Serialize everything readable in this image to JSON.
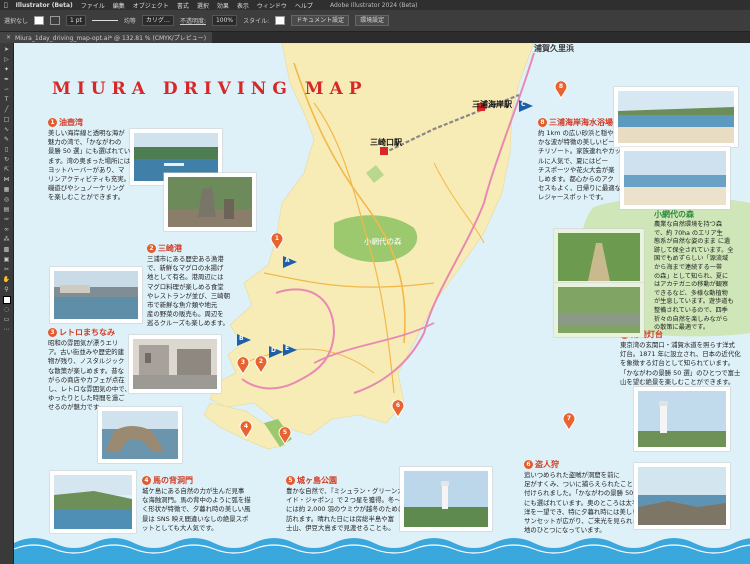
{
  "app": {
    "menu": [
      "Illustrator (Beta)",
      "ファイル",
      "編集",
      "オブジェクト",
      "書式",
      "選択",
      "効果",
      "表示",
      "ウィンドウ",
      "ヘルプ"
    ],
    "window_title": "Adobe Illustrator 2024 (Beta)",
    "control": {
      "selection_label": "選択なし",
      "stroke_weight": "1 pt",
      "stroke_profile": "均等",
      "brush": "カリグ…",
      "opacity_label": "不透明度:",
      "opacity_value": "100%",
      "style_label": "スタイル:",
      "doc_setup": "ドキュメント設定",
      "preferences": "環境設定"
    },
    "tab_label": "Miura_1day_driving_map-opt.ai* @ 132.81 % (CMYK/プレビュー)",
    "tab_close": "×"
  },
  "map": {
    "title": "MIURA DRIVING MAP",
    "top_cut_label": "浦賀久里浜",
    "stations": {
      "misakiguchi": "三崎口駅",
      "miurakaigan": "三浦海岸駅"
    },
    "forest_label": "小網代の森",
    "flags": [
      "A",
      "B",
      "C",
      "D",
      "E"
    ],
    "pins": [
      "1",
      "2",
      "3",
      "4",
      "5",
      "6",
      "7",
      "8"
    ],
    "spots": [
      {
        "num": "1",
        "title": "油壺湾",
        "text": [
          "美しい海岸線と透明な海が",
          "魅力の湾で、「かながわの",
          "景勝 50 選」にも選ばれてい",
          "ます。湾の奥まった場所には",
          "ヨットハーバーがあり、マ",
          "リンアクティビティも充実。",
          "磯遊びやシュノーケリング",
          "を楽しむことができます。"
        ]
      },
      {
        "num": "2",
        "title": "三崎港",
        "text": [
          "三浦市にある歴史ある漁港",
          "で、新鮮なマグロの水揚げ",
          "地として有名。港周辺には",
          "マグロ料理が楽しめる食堂",
          "やレストランが並び、三崎朝",
          "市で新鮮な魚介類や地元",
          "産の野菜の販売も。周辺を",
          "巡るクルーズも楽しめます。"
        ]
      },
      {
        "num": "3",
        "title": "レトロまちなみ",
        "text": [
          "昭和の雰囲気が漂うエリ",
          "ア。古い街並みや歴史的建",
          "物が残り、ノスタルジック",
          "な散策が楽しめます。昔な",
          "がらの商店やカフェが点在",
          "し、レトロな雰囲気の中で、",
          "ゆったりとした時間を過ご",
          "せるのが魅力です。"
        ]
      },
      {
        "num": "4",
        "title": "馬の背洞門",
        "text": [
          "城ケ島にある自然の力が生んだ見事",
          "な海蝕洞門。馬の背中のように弧を描",
          "く形状が特徴で、夕暮れ時の美しい風",
          "景は SNS 映え間違いなしの絶景スポ",
          "ットとしても大人気です。"
        ]
      },
      {
        "num": "5",
        "title": "城ヶ島公園",
        "text": [
          "豊かな自然で、『ミシュラン・グリーンガ",
          "イド・ジャポン』で２つ星を獲得。冬〜春",
          "には約 2,000 羽のウミウが越冬のために",
          "訪れます。晴れた日には房総半島や富",
          "士山、伊豆大島まで見渡せることも。"
        ]
      },
      {
        "num": "6",
        "title": "盗人狩",
        "text": [
          "追いつめられた盗賊が洞窟を前に",
          "足がすくみ、ついに捕らえられたことから名",
          "付けられました。「かながわの景勝 50 選」",
          "にも選ばれています。奥のところは太平",
          "洋を一望でき、特に夕暮れ時には美しい",
          "サンセットが広がり、ご来光を見られる景勝",
          "地のひとつになっています。"
        ]
      },
      {
        "num": "7",
        "title": "剱崎灯台",
        "text": [
          "東京湾の玄関口・浦賀水道を照らす洋式",
          "灯台。1871 年に設立され、日本の近代化",
          "を象徴する灯台として知られています。",
          "「かながわの景勝 50 選」のひとつで富士",
          "山を望む絶景を楽しむことができます。"
        ]
      },
      {
        "num": "8",
        "title": "三浦海岸海水浴場",
        "text": [
          "約 1km の広い砂浜と穏や",
          "かな波が特徴の美しいビー",
          "チリゾート。家族連れやカップ",
          "ルに人気で、夏にはビー",
          "チスポーツや花火大会が楽",
          "しめます。都心からのアク",
          "セスもよく、日帰りに最適な",
          "レジャースポットです。"
        ]
      }
    ],
    "koajiro": {
      "title": "小網代の森",
      "text": [
        "農業な自然環境を持つ森",
        "で、約 70ha のエリア生",
        "態系が自然な姿のまま に遺",
        "跡して保全されています。全",
        "国でもめずらしい「源流域",
        "から海まで連続する一帯",
        "の森」として知られ、夏に",
        "はアカテガニの移動が観察",
        "できるなど、多様な動植物",
        "が生息しています。遊歩道も",
        "整備されているので、四季",
        "折々の自然を楽しみながら",
        "の散策に最適です。"
      ]
    }
  },
  "colors": {
    "land": "#f8ecb6",
    "sea": "#dff1f8",
    "forest": "#9cc86e",
    "road_pink": "#e889b4",
    "road_yellow": "#f2b84a",
    "rail": "#888888",
    "accent_red": "#d62828",
    "pin": "#e8632f",
    "flag": "#1f5fa8"
  }
}
